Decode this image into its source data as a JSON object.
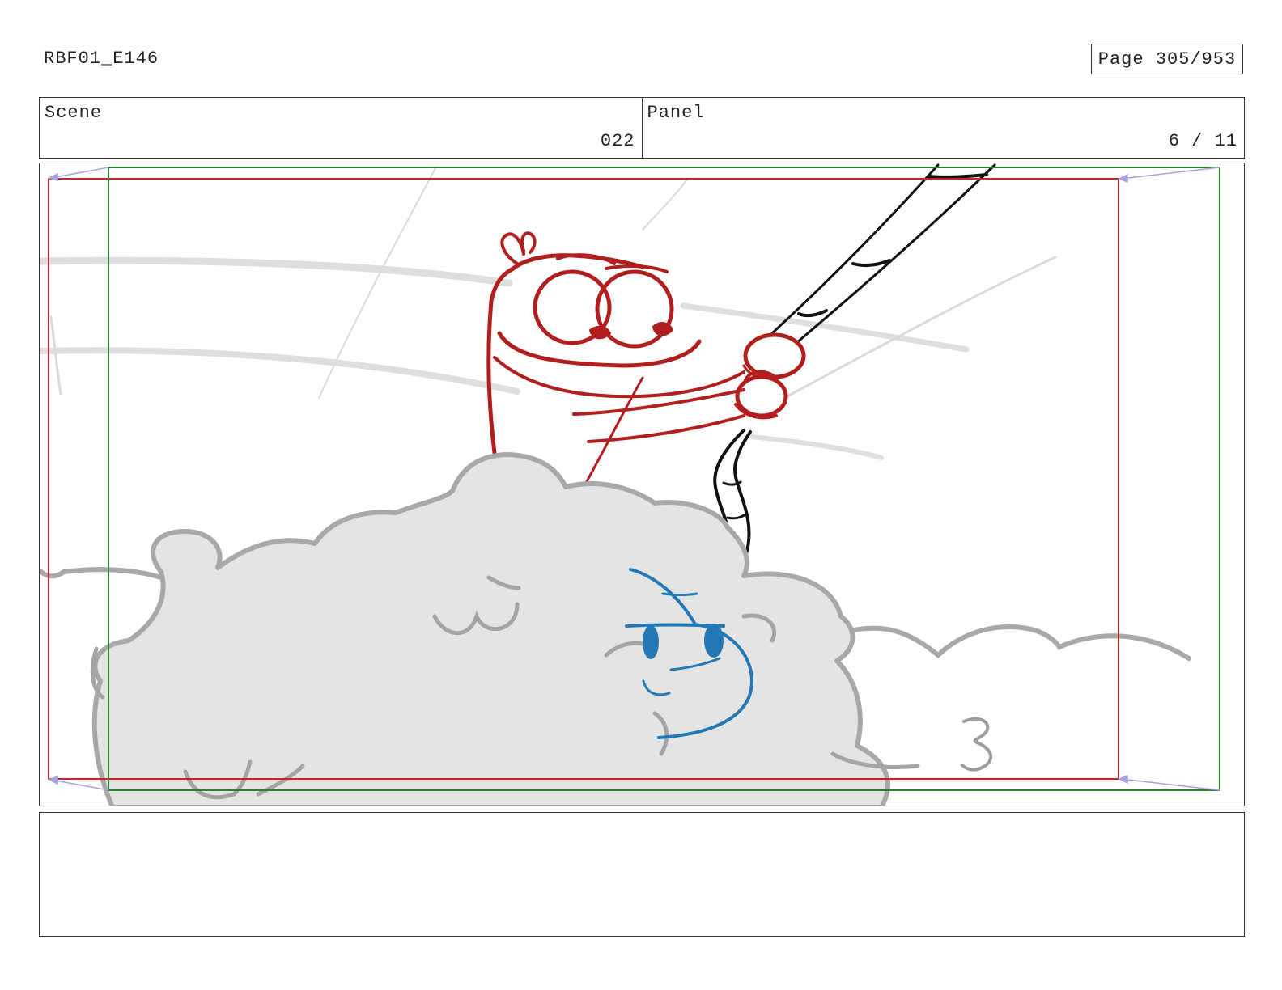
{
  "header": {
    "title": "RBF01_E146",
    "page_label": "Page 305/953"
  },
  "info": {
    "scene_label": "Scene",
    "scene_value": "022",
    "panel_label": "Panel",
    "panel_value": "6 / 11"
  },
  "notes": {
    "text": ""
  },
  "colors": {
    "safe_frame": "#c0262b",
    "camera_frame": "#2e7d32",
    "char_red": "#b01e1e",
    "char_blue": "#2479b5",
    "pole": "#111111",
    "cloud_fill": "#e4e4e4",
    "cloud_stroke": "#a6a6a6",
    "bg_lines": "#d6d6d6",
    "arrow": "#a7a3e0"
  }
}
